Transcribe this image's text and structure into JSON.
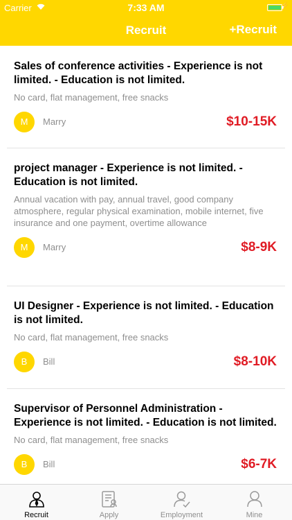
{
  "status_bar": {
    "carrier": "Carrier",
    "time": "7:33 AM"
  },
  "nav": {
    "title": "Recruit",
    "right_action": "+Recruit"
  },
  "jobs": [
    {
      "title": "Sales of conference activities - Experience is not limited. - Education is not limited.",
      "description": "No card, flat management, free snacks",
      "avatar_letter": "M",
      "poster": "Marry",
      "salary": "$10-15K"
    },
    {
      "title": "project manager - Experience is not limited. - Education is not limited.",
      "description": "Annual vacation with pay, annual travel, good company atmosphere, regular physical examination, mobile internet, five insurance and one payment, overtime allowance",
      "avatar_letter": "M",
      "poster": "Marry",
      "salary": "$8-9K"
    },
    {
      "title": "UI Designer - Experience is not limited. - Education is not limited.",
      "description": "No card, flat management, free snacks",
      "avatar_letter": "B",
      "poster": "Bill",
      "salary": "$8-10K"
    },
    {
      "title": "Supervisor of Personnel Administration - Experience is not limited. - Education is not limited.",
      "description": "No card, flat management, free snacks",
      "avatar_letter": "B",
      "poster": "Bill",
      "salary": "$6-7K"
    }
  ],
  "tabs": [
    {
      "label": "Recruit",
      "icon": "recruit-icon",
      "active": true
    },
    {
      "label": "Apply",
      "icon": "apply-icon",
      "active": false
    },
    {
      "label": "Employment",
      "icon": "employment-icon",
      "active": false
    },
    {
      "label": "Mine",
      "icon": "mine-icon",
      "active": false
    }
  ],
  "colors": {
    "accent": "#ffd700",
    "salary": "#e01b24",
    "muted": "#8e8e8e"
  }
}
